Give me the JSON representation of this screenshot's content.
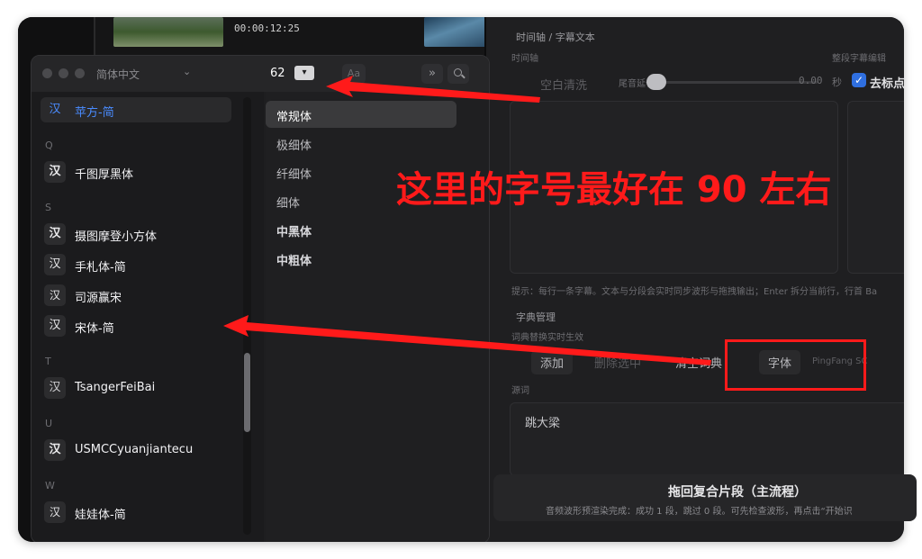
{
  "bg_app": {
    "timecode": "00:00:12:25",
    "section_title": "时间轴 / 字幕文本",
    "timeline_label": "时间轴",
    "subtitle_edit_label": "整段字幕编辑",
    "clear_button": "空白清洗",
    "tail_extend_label": "尾音延长",
    "tail_extend_value": "0.00",
    "seconds_unit": "秒",
    "remove_punct_label": "去标点",
    "hint_text": "提示：每行一条字幕。文本与分段会实时同步波形与拖拽输出；Enter 拆分当前行，行首 Ba",
    "dict_title": "字典管理",
    "dict_realtime": "词典替换实时生效",
    "add_button": "添加",
    "delete_button": "删除选中",
    "clear_dict_button": "清空词典",
    "font_button": "字体",
    "font_value": "PingFang SC",
    "source_word_label": "源词",
    "source_word_value": "跳大梁",
    "bottom_button": "拖回复合片段（主流程）",
    "bottom_note": "音频波形预渲染完成：成功 1 段，跳过 0 段。可先检查波形，再点击“开始识"
  },
  "font_panel": {
    "language": "简体中文",
    "size": "62",
    "aa_label": "Aa",
    "more_label": "»",
    "fonts": [
      {
        "glyph": "汉",
        "name": "苹方-简",
        "selected": true
      },
      {
        "letter": "Q"
      },
      {
        "glyph": "汉",
        "name": "千图厚黑体"
      },
      {
        "letter": "S"
      },
      {
        "glyph": "汉",
        "name": "摄图摩登小方体"
      },
      {
        "glyph": "汉",
        "name": "手札体-简"
      },
      {
        "glyph": "汉",
        "name": "司源赢宋"
      },
      {
        "glyph": "汉",
        "name": "宋体-简"
      },
      {
        "letter": "T"
      },
      {
        "glyph": "汉",
        "name": "TsangerFeiBai"
      },
      {
        "letter": "U"
      },
      {
        "glyph": "汉",
        "name": "USMCCyuanjiantecu"
      },
      {
        "letter": "W"
      },
      {
        "glyph": "汉",
        "name": "娃娃体-简"
      }
    ],
    "weights": [
      "常规体",
      "极细体",
      "纤细体",
      "细体",
      "中黑体",
      "中粗体"
    ]
  },
  "annotation": {
    "text": "这里的字号最好在 90 左右",
    "color": "#ff1a1a"
  }
}
